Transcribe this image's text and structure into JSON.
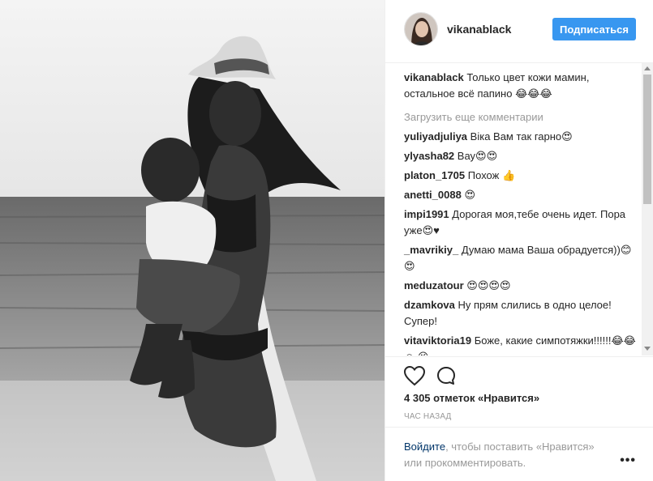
{
  "post": {
    "username": "vikanablack",
    "follow_label": "Подписаться",
    "caption_user": "vikanablack",
    "caption_text": " Только цвет кожи мамин, остальное всё папино 😂😂😂",
    "load_more": "Загрузить еще комментарии",
    "comments": [
      {
        "user": "yuliyadjuliya",
        "text": " Віка Вам так гарно😍"
      },
      {
        "user": "ylyasha82",
        "text": " Вау😍😍"
      },
      {
        "user": "platon_1705",
        "text": " Похож 👍"
      },
      {
        "user": "anetti_0088",
        "text": " 😍"
      },
      {
        "user": "impi1991",
        "text": " Дорогая моя,тебе очень идет. Пора уже😍♥"
      },
      {
        "user": "_mavrikiy_",
        "text": " Думаю мама Ваша обрадуется))😊😍"
      },
      {
        "user": "meduzatour",
        "text": " 😍😍😍😍"
      },
      {
        "user": "dzamkova",
        "text": " Ну прям слились в одно целое! Супер!"
      },
      {
        "user": "vitaviktoria19",
        "text": " Боже, какие симпотяжки!!!!!!😂😂☺ 😘"
      }
    ],
    "likes": "4 305 отметок «Нравится»",
    "time": "ЧАС НАЗАД",
    "login_link": "Войдите",
    "login_text": ", чтобы поставить «Нравится» или прокомментировать.",
    "more_dots": "•••"
  },
  "colors": {
    "accent": "#3897f0",
    "text": "#262626",
    "muted": "#999999",
    "link": "#003569"
  },
  "icons": [
    "heart-icon",
    "comment-icon",
    "more-options-icon"
  ]
}
